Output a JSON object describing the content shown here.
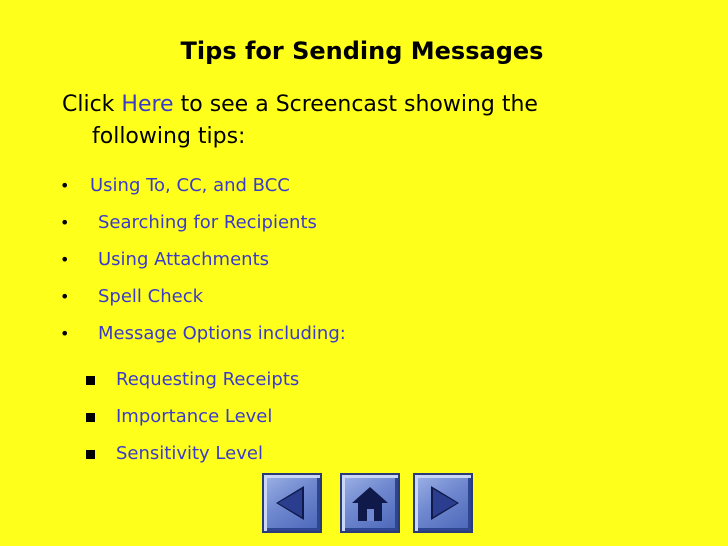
{
  "slide": {
    "title": "Tips for Sending Messages",
    "intro_prefix": "Click",
    "intro_link": "Here",
    "intro_suffix": "to see a Screencast showing the",
    "intro_line2": "following tips:",
    "bullets": [
      "Using To, CC, and BCC",
      "Searching for Recipients",
      "Using Attachments",
      "Spell Check",
      "Message Options including:"
    ],
    "sub_bullets": [
      "Requesting Receipts",
      "Importance Level",
      "Sensitivity Level"
    ]
  },
  "nav": {
    "prev_icon": "triangle-left-icon",
    "home_icon": "house-icon",
    "next_icon": "triangle-right-icon"
  },
  "colors": {
    "background": "#ffff1c",
    "link": "#3b3bc9",
    "button": "#6f88cf"
  }
}
